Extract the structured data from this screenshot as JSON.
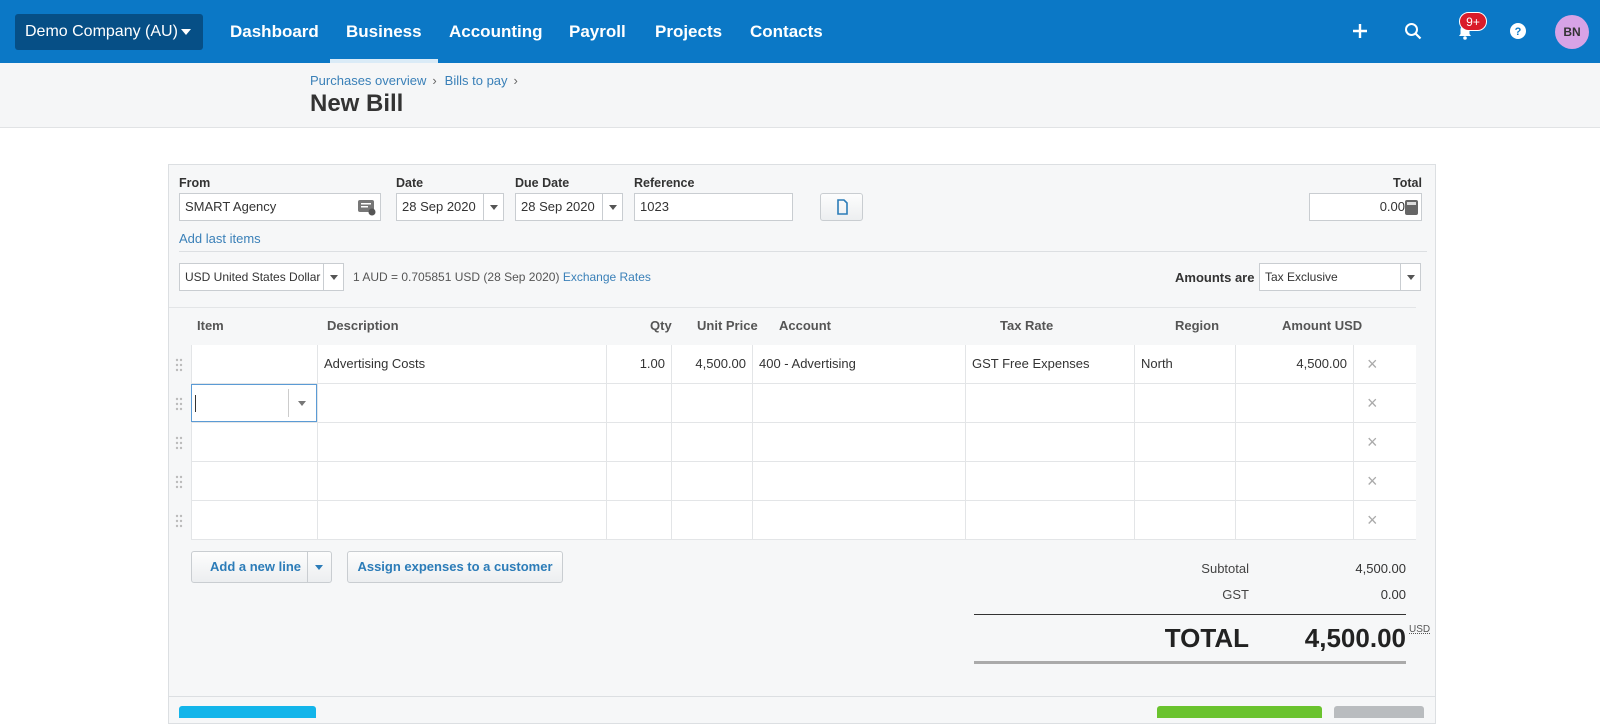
{
  "nav": {
    "org": "Demo Company (AU)",
    "items": [
      "Dashboard",
      "Business",
      "Accounting",
      "Payroll",
      "Projects",
      "Contacts"
    ],
    "notifications_badge": "9+",
    "avatar_initials": "BN"
  },
  "header": {
    "breadcrumbs": [
      "Purchases overview",
      "Bills to pay"
    ],
    "title": "New Bill"
  },
  "form": {
    "from_label": "From",
    "from_value": "SMART Agency",
    "date_label": "Date",
    "date_value": "28 Sep 2020",
    "due_label": "Due Date",
    "due_value": "28 Sep 2020",
    "ref_label": "Reference",
    "ref_value": "1023",
    "total_label": "Total",
    "total_value": "0.00",
    "add_last_items": "Add last items",
    "currency": "USD United States Dollar",
    "rate_text": "1 AUD = 0.705851 USD (28 Sep 2020)",
    "exchange_link": "Exchange Rates",
    "amounts_are_label": "Amounts are",
    "amounts_are_value": "Tax Exclusive"
  },
  "table": {
    "headers": [
      "Item",
      "Description",
      "Qty",
      "Unit Price",
      "Account",
      "Tax Rate",
      "Region",
      "Amount USD"
    ],
    "rows": [
      {
        "item": "",
        "description": "Advertising Costs",
        "qty": "1.00",
        "unit_price": "4,500.00",
        "account": "400 - Advertising",
        "tax_rate": "GST Free Expenses",
        "region": "North",
        "amount": "4,500.00"
      },
      {
        "item": "",
        "description": "",
        "qty": "",
        "unit_price": "",
        "account": "",
        "tax_rate": "",
        "region": "",
        "amount": ""
      },
      {
        "item": "",
        "description": "",
        "qty": "",
        "unit_price": "",
        "account": "",
        "tax_rate": "",
        "region": "",
        "amount": ""
      },
      {
        "item": "",
        "description": "",
        "qty": "",
        "unit_price": "",
        "account": "",
        "tax_rate": "",
        "region": "",
        "amount": ""
      },
      {
        "item": "",
        "description": "",
        "qty": "",
        "unit_price": "",
        "account": "",
        "tax_rate": "",
        "region": "",
        "amount": ""
      }
    ]
  },
  "actions": {
    "add_line": "Add a new line",
    "assign": "Assign expenses to a customer"
  },
  "totals": {
    "subtotal_label": "Subtotal",
    "subtotal_value": "4,500.00",
    "gst_label": "GST",
    "gst_value": "0.00",
    "total_label": "TOTAL",
    "total_value": "4,500.00",
    "currency": "USD"
  }
}
